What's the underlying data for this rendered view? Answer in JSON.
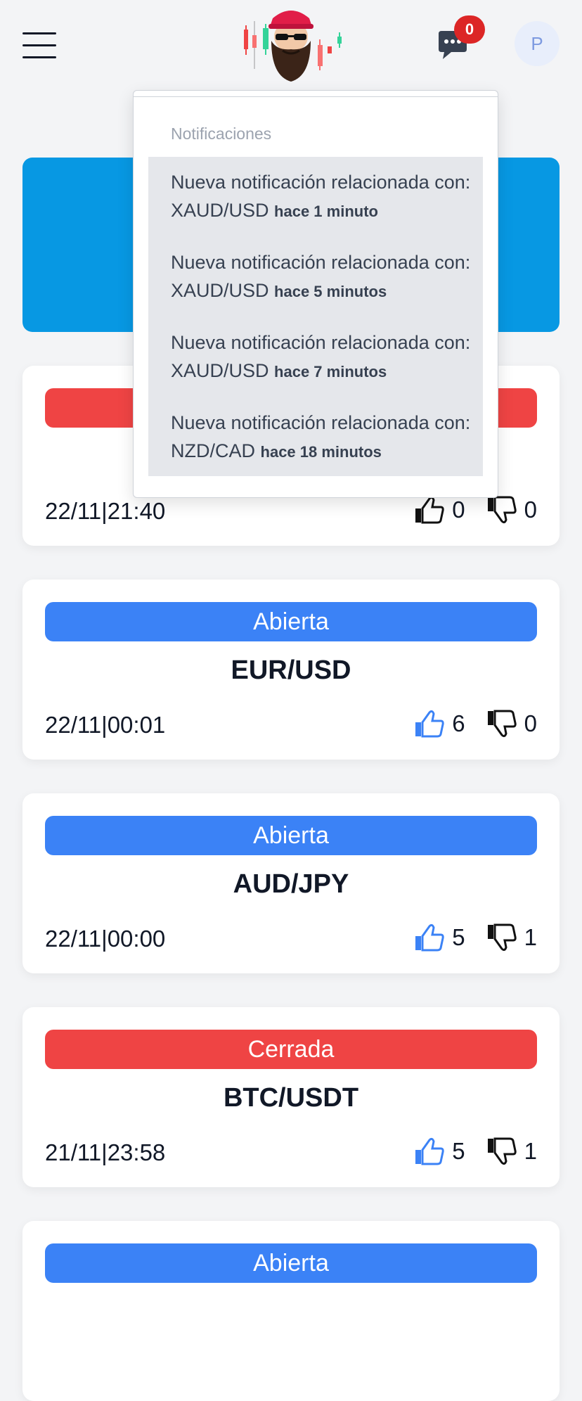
{
  "header": {
    "menu_icon": "hamburger-icon",
    "logo_icon": "bearded-trader-logo",
    "chat_icon": "chat-bubble-icon",
    "chat_badge": "0",
    "avatar_initial": "P"
  },
  "notifications": {
    "title": "Notificaciones",
    "items": [
      {
        "text": "Nueva notificación relacionada con: XAUD/USD",
        "ago": "hace 1 minuto"
      },
      {
        "text": "Nueva notificación relacionada con: XAUD/USD",
        "ago": "hace 5 minutos"
      },
      {
        "text": "Nueva notificación relacionada con: XAUD/USD",
        "ago": "hace 7 minutos"
      },
      {
        "text": "Nueva notificación relacionada con: NZD/CAD",
        "ago": "hace 18 minutos"
      }
    ]
  },
  "signals": [
    {
      "status": "",
      "status_kind": "closed",
      "pair": "",
      "date": "22/11|21:40",
      "likes": "0",
      "dislikes": "0"
    },
    {
      "status": "Abierta",
      "status_kind": "open",
      "pair": "EUR/USD",
      "date": "22/11|00:01",
      "likes": "6",
      "dislikes": "0"
    },
    {
      "status": "Abierta",
      "status_kind": "open",
      "pair": "AUD/JPY",
      "date": "22/11|00:00",
      "likes": "5",
      "dislikes": "1"
    },
    {
      "status": "Cerrada",
      "status_kind": "closed",
      "pair": "BTC/USDT",
      "date": "21/11|23:58",
      "likes": "5",
      "dislikes": "1"
    },
    {
      "status": "Abierta",
      "status_kind": "open",
      "pair": "",
      "date": "",
      "likes": "",
      "dislikes": ""
    }
  ],
  "colors": {
    "open": "#3b82f6",
    "closed": "#ef4444",
    "banner": "#0798e3",
    "badge": "#dc2626",
    "like_active": "#3b82f6"
  }
}
